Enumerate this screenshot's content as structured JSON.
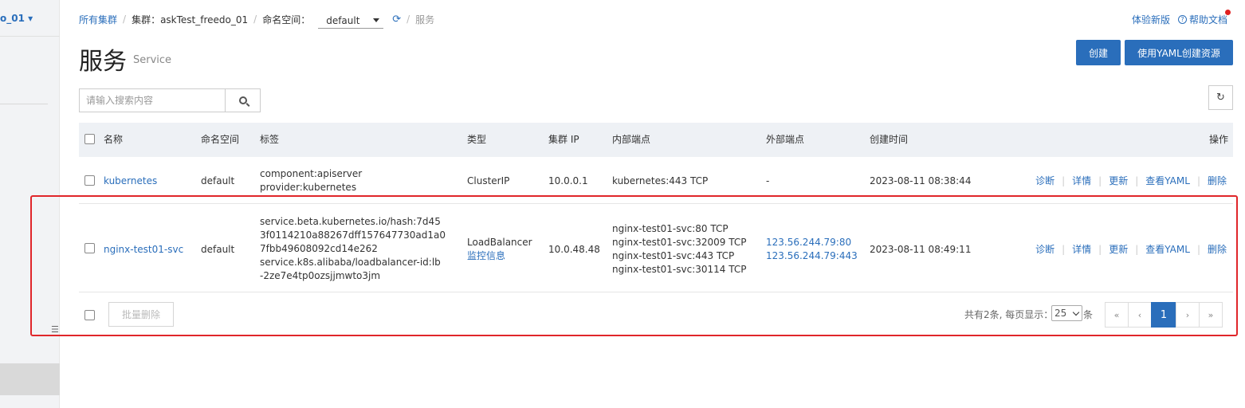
{
  "sidebar": {
    "cluster_name": "o_01 ▾"
  },
  "breadcrumb": {
    "all_clusters": "所有集群",
    "cluster_label": "集群：askTest_freedo_01",
    "namespace_label": "命名空间：",
    "namespace_value": "default",
    "current": "服务"
  },
  "top_links": {
    "new_version": "体验新版",
    "help": "帮助文档"
  },
  "header": {
    "title": "服务",
    "subtitle": "Service"
  },
  "buttons": {
    "create": "创建",
    "create_yaml": "使用YAML创建资源",
    "batch_delete": "批量删除"
  },
  "search": {
    "placeholder": "请输入搜索内容"
  },
  "table": {
    "columns": [
      "名称",
      "命名空间",
      "标签",
      "类型",
      "集群 IP",
      "内部端点",
      "外部端点",
      "创建时间",
      "操作"
    ],
    "rows": [
      {
        "name": "kubernetes",
        "namespace": "default",
        "labels": [
          "component:apiserver",
          "provider:kubernetes"
        ],
        "type": "ClusterIP",
        "type_extra": "",
        "cluster_ip": "10.0.0.1",
        "internal_endpoints": [
          "kubernetes:443 TCP"
        ],
        "external_endpoints": [
          "-"
        ],
        "created": "2023-08-11 08:38:44"
      },
      {
        "name": "nginx-test01-svc",
        "namespace": "default",
        "labels": [
          "service.beta.kubernetes.io/hash:7d45",
          "3f0114210a88267dff157647730ad1a0",
          "7fbb49608092cd14e262",
          "service.k8s.alibaba/loadbalancer-id:lb",
          "-2ze7e4tp0ozsjjmwto3jm"
        ],
        "type": "LoadBalancer",
        "type_extra": "监控信息",
        "cluster_ip": "10.0.48.48",
        "internal_endpoints": [
          "nginx-test01-svc:80 TCP",
          "nginx-test01-svc:32009 TCP",
          "nginx-test01-svc:443 TCP",
          "nginx-test01-svc:30114 TCP"
        ],
        "external_endpoints": [
          "123.56.244.79:80",
          "123.56.244.79:443"
        ],
        "created": "2023-08-11 08:49:11"
      }
    ],
    "actions": [
      "诊断",
      "详情",
      "更新",
      "查看YAML",
      "删除"
    ]
  },
  "pagination": {
    "summary": "共有2条, 每页显示：",
    "page_size": "25",
    "suffix": "条",
    "first": "«",
    "prev": "‹",
    "current": "1",
    "next": "›",
    "last": "»"
  },
  "colors": {
    "accent": "#2a6ebb",
    "highlight": "#e0262a"
  }
}
